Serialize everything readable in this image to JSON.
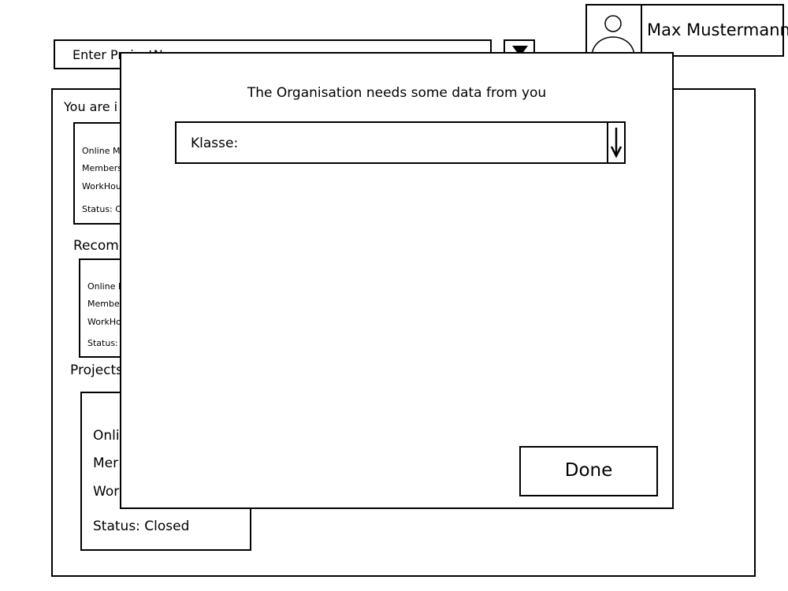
{
  "header": {
    "search_placeholder": "Enter ProjectName",
    "user_name": "Max Mustermann"
  },
  "main": {
    "heading": "You are i",
    "current_project": {
      "lines": [
        "Online M",
        "Members",
        "WorkHou",
        "Status: C"
      ]
    },
    "recommended_label": "Recomm",
    "recommended_project": {
      "lines": [
        "Online M",
        "Member",
        "WorkHo",
        "Status:"
      ]
    },
    "projects_label": "Projects",
    "closed_project": {
      "lines": [
        "Onli",
        "Mer",
        "Wor",
        "Status: Closed"
      ]
    }
  },
  "modal": {
    "title": "The Organisation needs some data from you",
    "select_label": "Klasse:",
    "done_label": "Done"
  }
}
